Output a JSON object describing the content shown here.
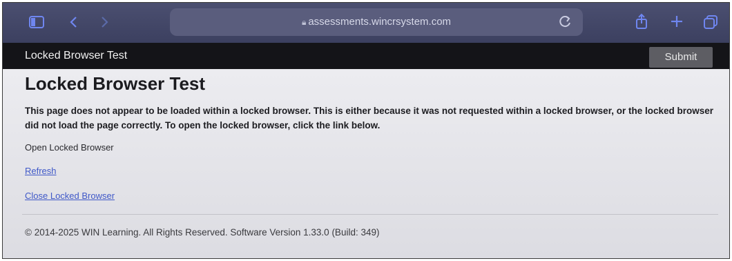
{
  "browser": {
    "url": "assessments.wincrsystem.com",
    "icons": {
      "sidebar": "sidebar-icon",
      "back": "chevron-left-icon",
      "forward": "chevron-right-icon",
      "reader": "reader-mode-icon",
      "lock": "lock-icon",
      "reload": "reload-icon",
      "share": "share-icon",
      "new_tab": "plus-icon",
      "tabs": "tabs-overview-icon"
    },
    "accent_color": "#6f86f0"
  },
  "appbar": {
    "title": "Locked Browser Test",
    "submit_label": "Submit"
  },
  "main": {
    "title": "Locked Browser Test",
    "message": "This page does not appear to be loaded within a locked browser. This is either because it was not requested within a locked browser, or the locked browser did not load the page correctly. To open the locked browser, click the link below.",
    "open_label": "Open Locked Browser",
    "refresh_label": "Refresh",
    "close_label": "Close Locked Browser",
    "link_color": "#3f58c8"
  },
  "footer": {
    "text": "© 2014-2025 WIN Learning. All Rights Reserved. Software Version 1.33.0 (Build: 349)"
  }
}
